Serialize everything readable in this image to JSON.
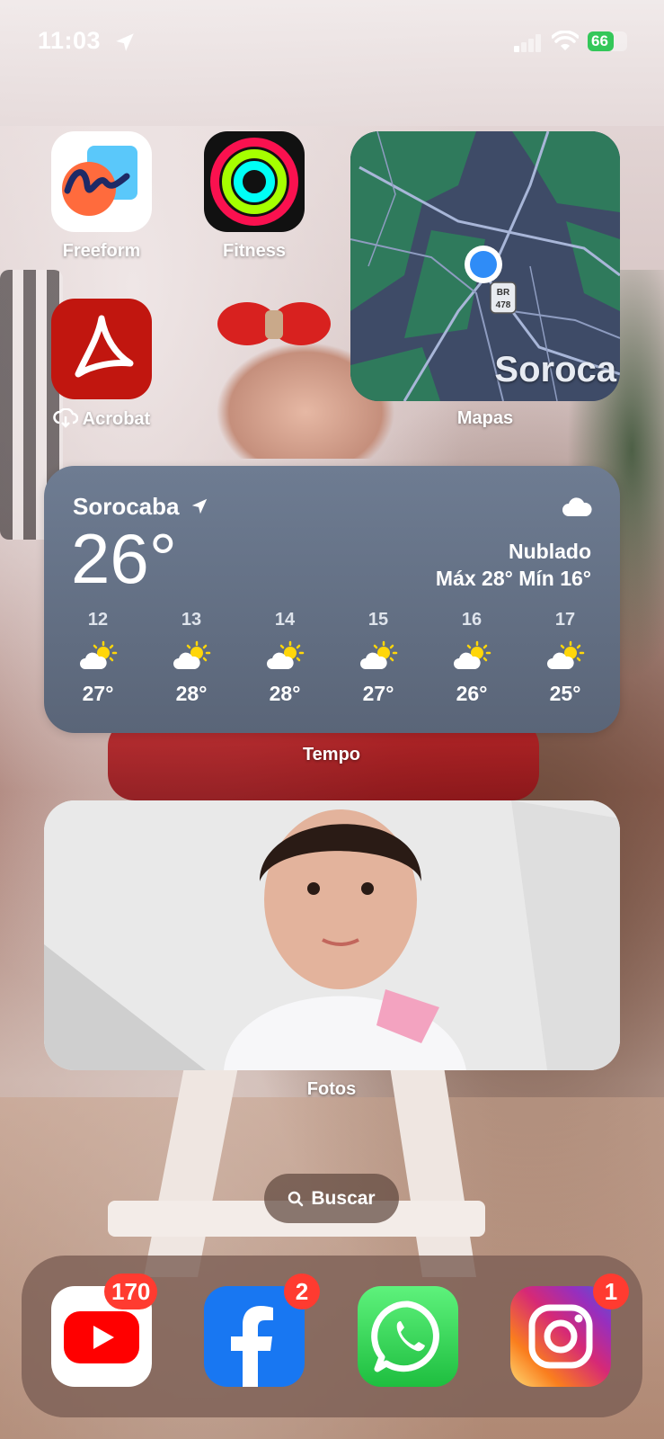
{
  "status_bar": {
    "time": "11:03",
    "battery_percent": "66",
    "battery_level": 0.66
  },
  "apps": {
    "freeform": {
      "label": "Freeform"
    },
    "fitness": {
      "label": "Fitness"
    },
    "acrobat": {
      "label": "Acrobat",
      "downloading": true
    }
  },
  "maps_widget": {
    "label": "Mapas",
    "city_text": "Soroca",
    "road_sign_top": "BR",
    "road_sign_bottom": "478"
  },
  "weather_widget": {
    "label": "Tempo",
    "city": "Sorocaba",
    "temperature": "26°",
    "condition": "Nublado",
    "range": "Máx 28° Mín 16°",
    "forecast": [
      {
        "hour": "12",
        "temp": "27°",
        "icon": "partly-cloudy-icon"
      },
      {
        "hour": "13",
        "temp": "28°",
        "icon": "partly-cloudy-icon"
      },
      {
        "hour": "14",
        "temp": "28°",
        "icon": "partly-cloudy-icon"
      },
      {
        "hour": "15",
        "temp": "27°",
        "icon": "partly-cloudy-icon"
      },
      {
        "hour": "16",
        "temp": "26°",
        "icon": "partly-cloudy-icon"
      },
      {
        "hour": "17",
        "temp": "25°",
        "icon": "partly-cloudy-icon"
      }
    ]
  },
  "photos_widget": {
    "label": "Fotos"
  },
  "search": {
    "label": "Buscar"
  },
  "dock": {
    "youtube": {
      "badge": "170"
    },
    "facebook": {
      "badge": "2"
    },
    "whatsapp": {
      "badge": ""
    },
    "instagram": {
      "badge": "1"
    }
  },
  "colors": {
    "badge_red": "#ff3b30",
    "weather_bg": "#66738a",
    "acrobat_red": "#c1160f",
    "facebook_blue": "#1877f2",
    "whatsapp_green": "#25d366",
    "youtube_red": "#ff0000"
  }
}
